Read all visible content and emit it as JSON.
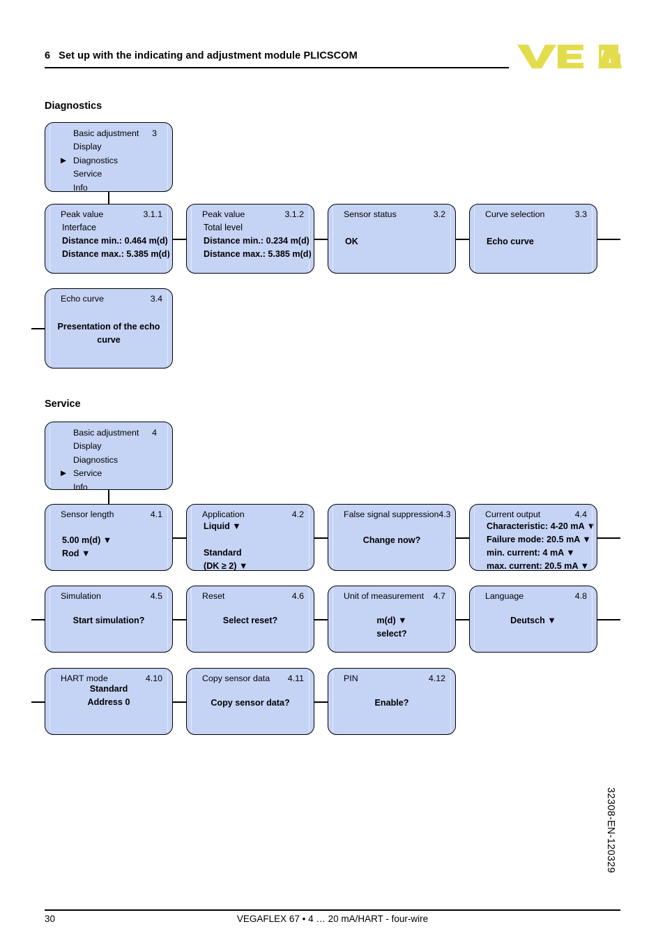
{
  "header": {
    "chapter_number": "6",
    "title": "Set up with the indicating and adjustment module PLICSCOM",
    "logo_text": "VEGA",
    "logo_color": "#e3dd4e"
  },
  "sections": [
    {
      "id": "diagnostics",
      "title": "Diagnostics"
    },
    {
      "id": "service",
      "title": "Service"
    }
  ],
  "colors": {
    "box_fill": "#c5d3f5",
    "box_border": "#000000",
    "line": "#000000"
  },
  "diagnostics": {
    "menu": {
      "number": "3",
      "items": [
        {
          "label": "Basic adjustment",
          "selected": false
        },
        {
          "label": "Display",
          "selected": false
        },
        {
          "label": "Diagnostics",
          "selected": true
        },
        {
          "label": "Service",
          "selected": false
        },
        {
          "label": "Info",
          "selected": false
        }
      ],
      "marker": "▶"
    },
    "boxes": [
      {
        "title": "Peak value",
        "number": "3.1.1",
        "subtitle": "Interface",
        "lines": [
          {
            "text": "Distance min.: 0.464 m(d)",
            "bold": true
          },
          {
            "text": "Distance max.: 5.385 m(d)",
            "bold": true
          }
        ]
      },
      {
        "title": "Peak value",
        "number": "3.1.2",
        "subtitle": "Total level",
        "lines": [
          {
            "text": "Distance min.: 0.234 m(d)",
            "bold": true
          },
          {
            "text": "Distance max.: 5.385 m(d)",
            "bold": true
          }
        ]
      },
      {
        "title": "Sensor status",
        "number": "3.2",
        "subtitle": "",
        "lines": [
          {
            "text": "OK",
            "bold": true
          }
        ]
      },
      {
        "title": "Curve selection",
        "number": "3.3",
        "subtitle": "",
        "lines": [
          {
            "text": "Echo curve",
            "bold": true
          }
        ]
      },
      {
        "title": "Echo curve",
        "number": "3.4",
        "subtitle": "",
        "lines": [
          {
            "text": "Presentation of the echo",
            "bold": true
          },
          {
            "text": "curve",
            "bold": true
          }
        ]
      }
    ]
  },
  "service": {
    "menu": {
      "number": "4",
      "items": [
        {
          "label": "Basic adjustment",
          "selected": false
        },
        {
          "label": "Display",
          "selected": false
        },
        {
          "label": "Diagnostics",
          "selected": false
        },
        {
          "label": "Service",
          "selected": true
        },
        {
          "label": "Info",
          "selected": false
        }
      ],
      "marker": "▶"
    },
    "boxes": [
      {
        "title": "Sensor length",
        "number": "4.1",
        "lines": [
          {
            "text": "5.00 m(d) ▼",
            "bold": true
          },
          {
            "text": "Rod ▼",
            "bold": true
          }
        ]
      },
      {
        "title": "Application",
        "number": "4.2",
        "lines": [
          {
            "text": "Liquid ▼",
            "bold": true
          },
          {
            "text": "",
            "bold": false
          },
          {
            "text": "Standard",
            "bold": true
          },
          {
            "text": "(DK ≥ 2) ▼",
            "bold": true
          }
        ]
      },
      {
        "title": "False signal suppression",
        "number": "4.3",
        "lines": [
          {
            "text": "Change now?",
            "bold": true
          }
        ]
      },
      {
        "title": "Current output",
        "number": "4.4",
        "lines": [
          {
            "text": "Characteristic: 4-20 mA ▼",
            "bold": true
          },
          {
            "text": "Failure mode: 20.5 mA ▼",
            "bold": true
          },
          {
            "text": "min. current: 4 mA ▼",
            "bold": true
          },
          {
            "text": "max. current: 20.5 mA ▼",
            "bold": true
          }
        ]
      },
      {
        "title": "Simulation",
        "number": "4.5",
        "lines": [
          {
            "text": "Start simulation?",
            "bold": true
          }
        ]
      },
      {
        "title": "Reset",
        "number": "4.6",
        "lines": [
          {
            "text": "Select reset?",
            "bold": true
          }
        ]
      },
      {
        "title": "Unit of measurement",
        "number": "4.7",
        "lines": [
          {
            "text": "m(d) ▼",
            "bold": true
          },
          {
            "text": "select?",
            "bold": true
          }
        ]
      },
      {
        "title": "Language",
        "number": "4.8",
        "lines": [
          {
            "text": "Deutsch ▼",
            "bold": true
          }
        ]
      },
      {
        "title": "HART mode",
        "number": "4.10",
        "lines": [
          {
            "text": "Standard",
            "bold": true
          },
          {
            "text": "Address 0",
            "bold": true
          }
        ]
      },
      {
        "title": "Copy sensor data",
        "number": "4.11",
        "lines": [
          {
            "text": "Copy sensor data?",
            "bold": true
          }
        ]
      },
      {
        "title": "PIN",
        "number": "4.12",
        "lines": [
          {
            "text": "Enable?",
            "bold": true
          }
        ]
      }
    ]
  },
  "footer": {
    "page_number": "30",
    "product": "VEGAFLEX 67 • 4 … 20 mA/HART - four-wire",
    "doc_code": "32308-EN-120329"
  }
}
